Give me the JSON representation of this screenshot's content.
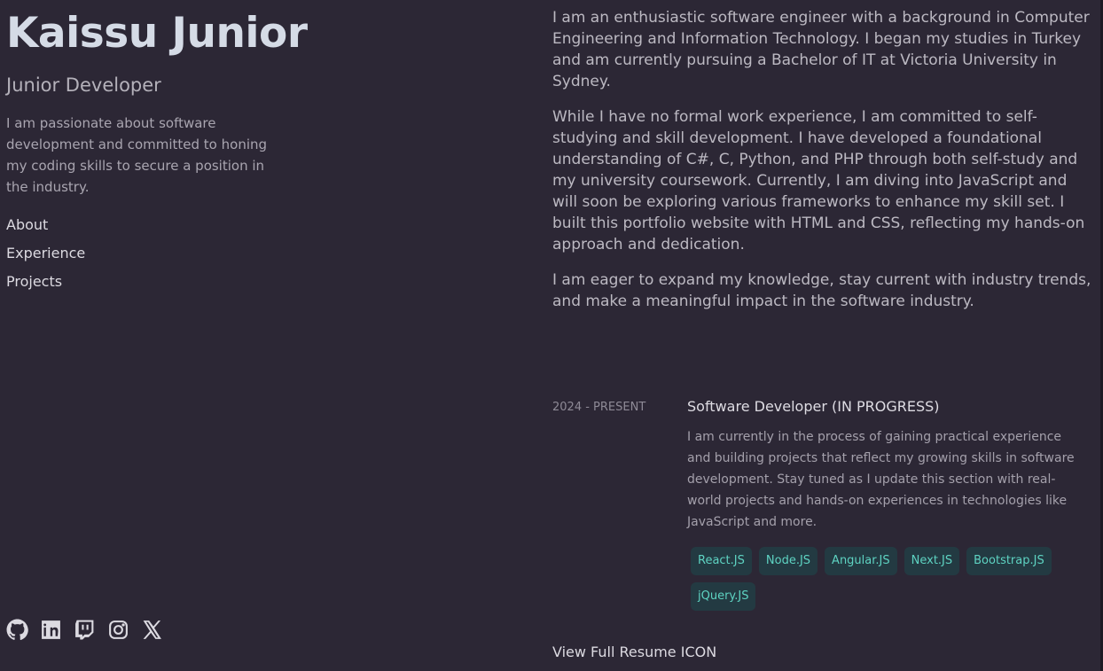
{
  "header": {
    "name": "Kaissu Junior",
    "role": "Junior Developer",
    "tagline": "I am passionate about software development and committed to honing my coding skills to secure a position in the industry."
  },
  "nav": {
    "items": [
      {
        "label": "About"
      },
      {
        "label": "Experience"
      },
      {
        "label": "Projects"
      }
    ]
  },
  "social": {
    "icons": [
      "github-icon",
      "linkedin-icon",
      "twitch-icon",
      "instagram-icon",
      "x-icon"
    ]
  },
  "about": {
    "paragraphs": [
      "I am an enthusiastic software engineer with a background in Computer Engineering and Information Technology. I began my studies in Turkey and am currently pursuing a Bachelor of IT at Victoria University in Sydney.",
      "While I have no formal work experience, I am committed to self-studying and skill development. I have developed a foundational understanding of C#, C, Python, and PHP through both self-study and my university coursework. Currently, I am diving into JavaScript and will soon be exploring various frameworks to enhance my skill set. I built this portfolio website with HTML and CSS, reflecting my hands-on approach and dedication.",
      "I am eager to expand my knowledge, stay current with industry trends, and make a meaningful impact in the software industry."
    ]
  },
  "experience": {
    "date": "2024 - PRESENT",
    "title": "Software Developer (IN PROGRESS)",
    "description": "I am currently in the process of gaining practical experience and building projects that reflect my growing skills in software development. Stay tuned as I update this section with real-world projects and hands-on experiences in technologies like JavaScript and more.",
    "tags": [
      "React.JS",
      "Node.JS",
      "Angular.JS",
      "Next.JS",
      "Bootstrap.JS",
      "jQuery.JS"
    ]
  },
  "resume": {
    "label": "View Full Resume ICON"
  },
  "colors": {
    "background": "#2c2735",
    "accent": "#5ed3c2",
    "tag_background": "#233a42"
  }
}
